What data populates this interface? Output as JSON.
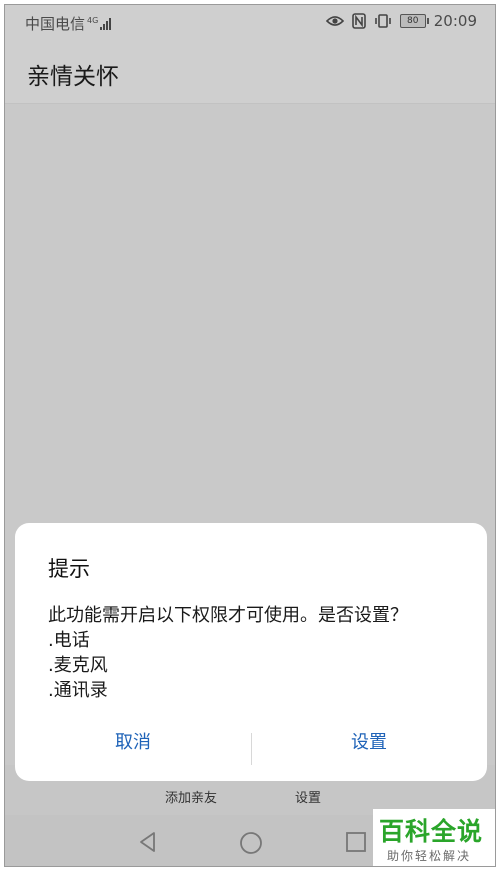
{
  "status": {
    "carrier": "中国电信",
    "network": "4G",
    "battery": "80",
    "time": "20:09"
  },
  "app": {
    "title": "亲情关怀"
  },
  "dialog": {
    "title": "提示",
    "lines": [
      "此功能需开启以下权限才可使用。是否设置？",
      ".电话",
      ".麦克风",
      ".通讯录"
    ],
    "cancel_label": "取消",
    "confirm_label": "设置"
  },
  "tabs": [
    {
      "label": "添加亲友"
    },
    {
      "label": "设置"
    }
  ],
  "watermark": {
    "brand": "百科全说",
    "slogan": "助你轻松解决"
  },
  "colors": {
    "accent": "#1f63b8",
    "watermark_green": "#2aa52a",
    "overlay_gray": "#c9c9c9"
  }
}
